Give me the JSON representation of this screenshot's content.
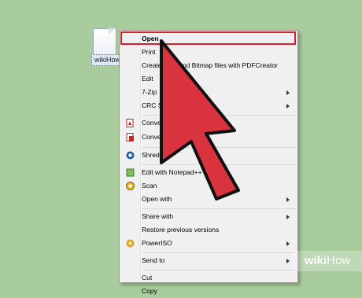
{
  "file": {
    "name": "wikiHow"
  },
  "menu": {
    "items": [
      {
        "label": "Open",
        "bold": true
      },
      {
        "label": "Print"
      },
      {
        "label": "Create PDF and Bitmap files with PDFCreator"
      },
      {
        "label": "Edit"
      },
      {
        "label": "7-Zip",
        "submenu": true
      },
      {
        "label": "CRC SHA",
        "submenu": true
      },
      {
        "label": "Convert to Adobe PDF",
        "icon": "pdf-icon"
      },
      {
        "label": "Convert to Adobe PDF",
        "icon": "pdf-icon"
      },
      {
        "label": "Shred File",
        "icon": "shred-icon"
      },
      {
        "label": "Edit with Notepad++",
        "icon": "notepad-icon"
      },
      {
        "label": "Scan",
        "icon": "scan-icon"
      },
      {
        "label": "Open with",
        "submenu": true
      },
      {
        "label": "Share with",
        "submenu": true
      },
      {
        "label": "Restore previous versions"
      },
      {
        "label": "PowerISO",
        "submenu": true,
        "icon": "poweriso-icon"
      },
      {
        "label": "Send to",
        "submenu": true
      },
      {
        "label": "Cut"
      },
      {
        "label": "Copy"
      }
    ]
  },
  "colors": {
    "arrow": "#d9333f",
    "highlight": "#d8202a",
    "background": "#a9cc9d"
  },
  "watermark": {
    "wiki": "wiki",
    "how": "How"
  }
}
